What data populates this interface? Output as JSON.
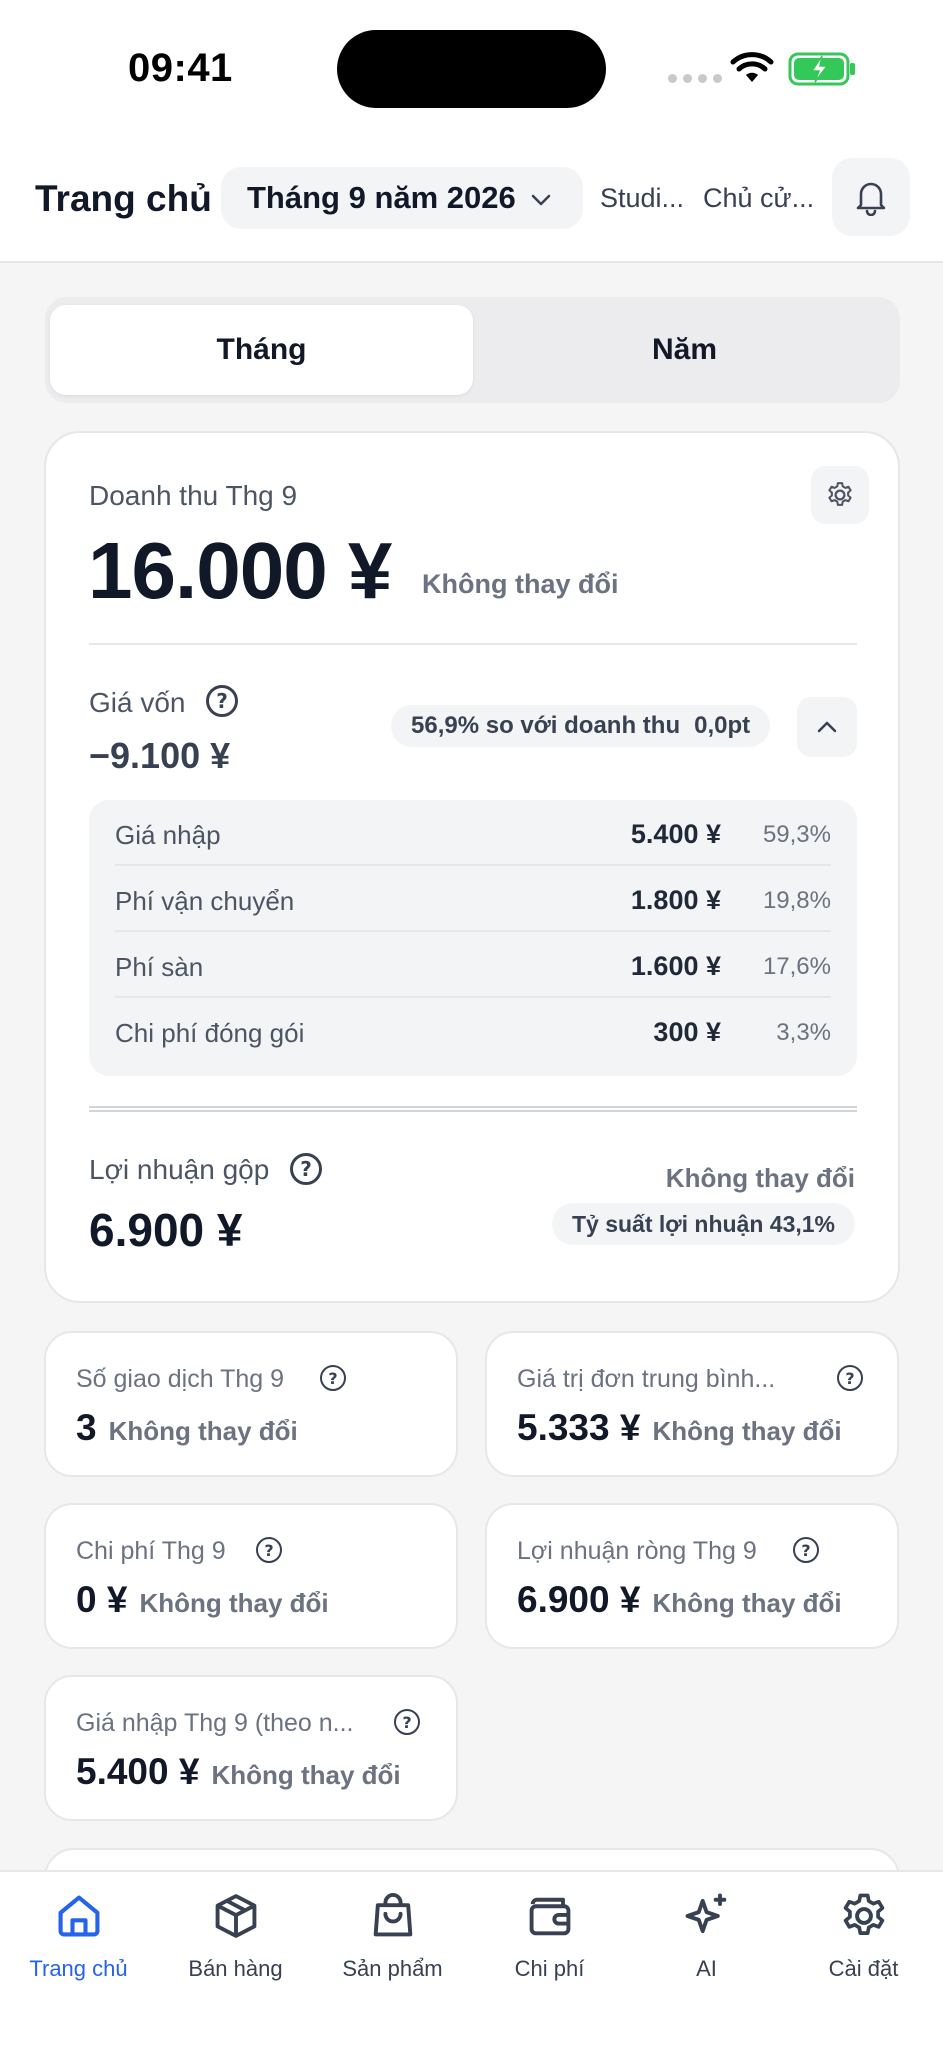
{
  "status_bar": {
    "time": "09:41"
  },
  "header": {
    "title": "Trang chủ",
    "month_selector": "Tháng 9 năm 2026",
    "store": "Studi...",
    "owner": "Chủ cử..."
  },
  "segment": {
    "month": "Tháng",
    "year": "Năm",
    "selected": "Tháng"
  },
  "revenue": {
    "label": "Doanh thu Thg 9",
    "value": "16.000 ¥",
    "change": "Không thay đổi"
  },
  "cogs": {
    "label": "Giá vốn",
    "help": "?",
    "value": "−9.100 ¥",
    "ratio_text": "56,9% so với doanh thu",
    "ratio_change": "0,0pt",
    "breakdown": [
      {
        "label": "Giá nhập",
        "amount": "5.400 ¥",
        "pct": "59,3%"
      },
      {
        "label": "Phí vận chuyển",
        "amount": "1.800 ¥",
        "pct": "19,8%"
      },
      {
        "label": "Phí sàn",
        "amount": "1.600 ¥",
        "pct": "17,6%"
      },
      {
        "label": "Chi phí đóng gói",
        "amount": "300 ¥",
        "pct": "3,3%"
      }
    ]
  },
  "gross_profit": {
    "label": "Lợi nhuận gộp",
    "help": "?",
    "value": "6.900 ¥",
    "change": "Không thay đổi",
    "margin": "Tỷ suất lợi nhuận 43,1%"
  },
  "metrics": [
    {
      "label": "Số giao dịch Thg 9",
      "value": "3",
      "change": "Không thay đổi",
      "help": "?"
    },
    {
      "label": "Giá trị đơn trung bình...",
      "value": "5.333 ¥",
      "change": "Không thay đổi",
      "help": "?"
    },
    {
      "label": "Chi phí Thg 9",
      "value": "0 ¥",
      "change": "Không thay đổi",
      "help": "?"
    },
    {
      "label": "Lợi nhuận ròng Thg 9",
      "value": "6.900 ¥",
      "change": "Không thay đổi",
      "help": "?"
    },
    {
      "label": "Giá nhập Thg 9 (theo n...",
      "value": "5.400 ¥",
      "change": "Không thay đổi",
      "help": "?"
    }
  ],
  "bottom_nav": [
    {
      "label": "Trang chủ",
      "icon": "home-icon",
      "active": true
    },
    {
      "label": "Bán hàng",
      "icon": "box-icon",
      "active": false
    },
    {
      "label": "Sản phẩm",
      "icon": "shopping-bag-icon",
      "active": false
    },
    {
      "label": "Chi phí",
      "icon": "wallet-icon",
      "active": false
    },
    {
      "label": "AI",
      "icon": "sparkles-icon",
      "active": false
    },
    {
      "label": "Cài đặt",
      "icon": "gear-icon",
      "active": false
    }
  ],
  "colors": {
    "accent": "#2563eb",
    "text_primary": "#111827",
    "text_muted": "#6b7280",
    "background": "#f5f5f6",
    "battery_green": "#34c759"
  }
}
